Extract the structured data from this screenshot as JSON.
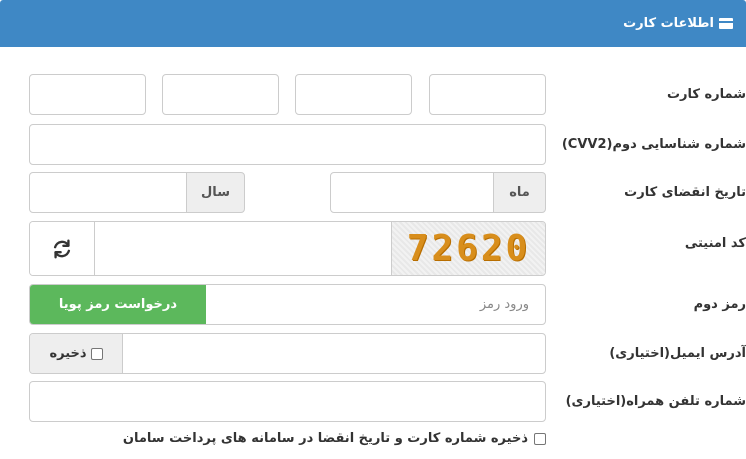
{
  "header": {
    "title": "اطلاعات کارت",
    "icon": "credit-card-icon"
  },
  "form": {
    "card_number_label": "شماره کارت",
    "cvv2_label": "شماره شناسایی دوم(CVV2)",
    "expiry_label": "تاریخ انقضای کارت",
    "month_addon": "ماه",
    "year_addon": "سال",
    "captcha_label": "کد امنیتی",
    "captcha_code": "72620",
    "second_password_label": "رمز دوم",
    "second_password_placeholder": "ورود رمز",
    "dynamic_password_button": "درخواست رمز پویا",
    "email_label": "آدرس ایمیل(اختیاری)",
    "email_save_label": "ذخیره",
    "mobile_label": "شماره تلفن همراه(اختیاری)",
    "save_card_text": "ذخیره شماره کارت و تاریخ انقضا در سامانه های پرداخت سامان"
  },
  "colors": {
    "header_bg": "#3f88c5",
    "button_green": "#5cb85c",
    "captcha_text": "#d88e1c"
  }
}
